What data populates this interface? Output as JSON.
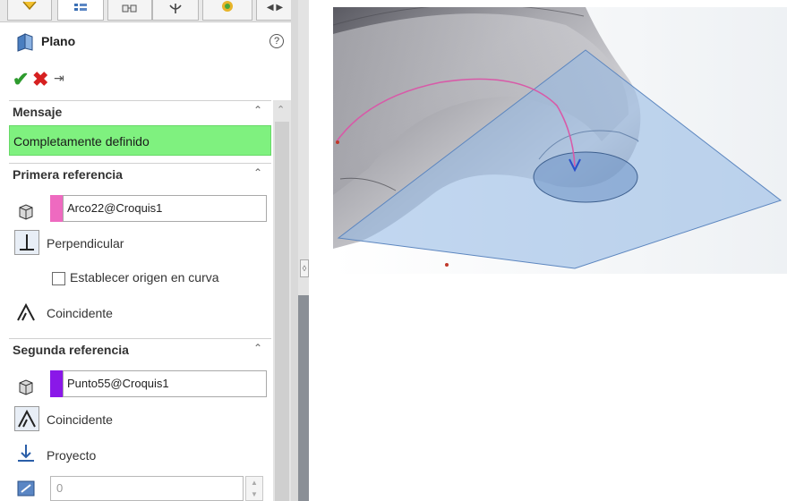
{
  "tabs": [
    {
      "name": "feature-manager"
    },
    {
      "name": "property-manager"
    },
    {
      "name": "configuration-manager"
    },
    {
      "name": "dimxpert-manager"
    },
    {
      "name": "display-manager"
    }
  ],
  "header": {
    "title": "Plano",
    "help_glyph": "?"
  },
  "mensaje": {
    "title": "Mensaje",
    "text": "Completamente definido"
  },
  "primera_referencia": {
    "title": "Primera referencia",
    "value": "Arco22@Croquis1",
    "color": "#ee6ac0",
    "options": {
      "perpendicular": "Perpendicular",
      "establecer": "Establecer origen en curva",
      "coincidente": "Coincidente"
    }
  },
  "segunda_referencia": {
    "title": "Segunda referencia",
    "value": "Punto55@Croquis1",
    "color": "#8a18e8",
    "options": {
      "coincidente": "Coincidente",
      "proyecto": "Proyecto"
    },
    "angle_value": "0"
  },
  "viewport": {
    "plane_color": "#8fb6e3",
    "surface_color": "#9a9aa2",
    "curve_color": "#d85aa8"
  }
}
